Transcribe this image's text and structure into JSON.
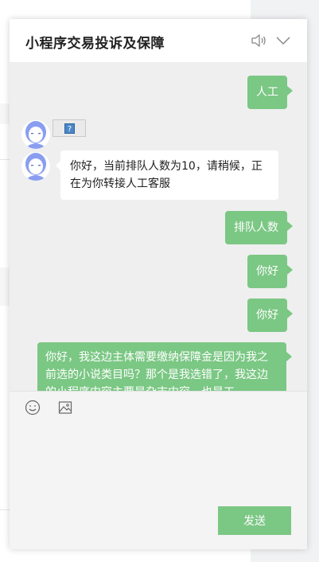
{
  "header": {
    "title": "小程序交易投诉及保障",
    "speaker_icon": "speaker-icon",
    "collapse_icon": "chevron-down-icon"
  },
  "messages": [
    {
      "side": "right",
      "text": "人工"
    },
    {
      "side": "left",
      "type": "image-placeholder",
      "icon": "broken-image-icon"
    },
    {
      "side": "left",
      "text": "你好，当前排队人数为10，请稍候，正在为你转接人工客服"
    },
    {
      "side": "right",
      "text": "排队人数"
    },
    {
      "side": "right",
      "text": "你好"
    },
    {
      "side": "right",
      "text": "你好"
    },
    {
      "side": "right",
      "text": "你好，我这边主体需要缴纳保障金是因为我之前选的小说类目吗？那个是我选错了，我这边的小程序内容主要是杂志内容，也是工"
    }
  ],
  "composer": {
    "emoji_icon": "emoji-icon",
    "image_icon": "image-icon",
    "input_value": "",
    "send_label": "发送"
  },
  "colors": {
    "accent": "#7bc784",
    "chat_bg": "#efefef"
  }
}
